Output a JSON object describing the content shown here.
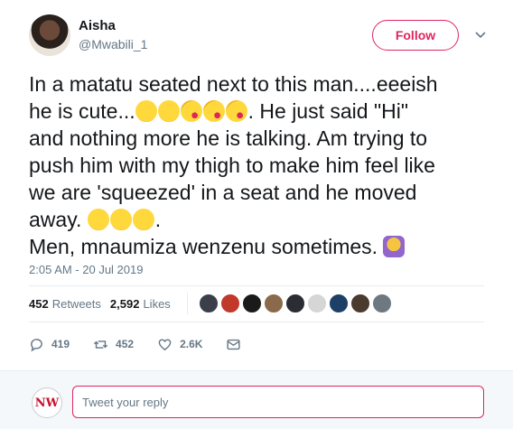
{
  "author": {
    "name": "Aisha",
    "handle": "@Mwabili_1"
  },
  "follow_label": "Follow",
  "tweet": {
    "line1": "In a matatu seated next to this man....eeeish",
    "line2a": "he is cute...",
    "line2b": ". He just said \"Hi\"",
    "line3": "and nothing more he is talking. Am trying to",
    "line4": "push him with my thigh to make him feel like",
    "line5": "we are 'squeezed' in a seat and he moved",
    "line6a": "away. ",
    "line6b": ".",
    "line7": "Men, mnaumiza wenzenu sometimes. "
  },
  "timestamp": "2:05 AM - 20 Jul 2019",
  "stats": {
    "retweets_count": "452",
    "retweets_label": "Retweets",
    "likes_count": "2,592",
    "likes_label": "Likes"
  },
  "actions": {
    "replies": "419",
    "retweets": "452",
    "likes": "2.6K"
  },
  "reply": {
    "avatar_text": "NW",
    "placeholder": "Tweet your reply"
  },
  "colors": {
    "accent": "#e0245e",
    "muted": "#657786",
    "text": "#14171a"
  },
  "icons": {
    "emoji_relieved": "relieved-face",
    "emoji_kiss": "face-blowing-kiss",
    "emoji_smirk": "smirking-face",
    "emoji_facepalm": "person-facepalming"
  }
}
